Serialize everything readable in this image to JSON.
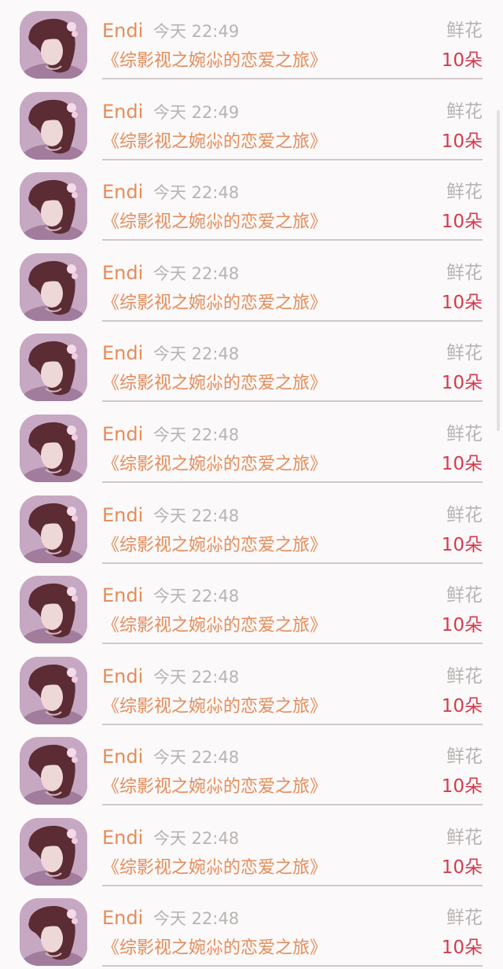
{
  "rows": [
    {
      "name": "Endi",
      "time": "今天 22:49",
      "type": "鲜花",
      "book": "《综影视之婉尛的恋爱之旅》",
      "amount": "10朵"
    },
    {
      "name": "Endi",
      "time": "今天 22:49",
      "type": "鲜花",
      "book": "《综影视之婉尛的恋爱之旅》",
      "amount": "10朵"
    },
    {
      "name": "Endi",
      "time": "今天 22:48",
      "type": "鲜花",
      "book": "《综影视之婉尛的恋爱之旅》",
      "amount": "10朵"
    },
    {
      "name": "Endi",
      "time": "今天 22:48",
      "type": "鲜花",
      "book": "《综影视之婉尛的恋爱之旅》",
      "amount": "10朵"
    },
    {
      "name": "Endi",
      "time": "今天 22:48",
      "type": "鲜花",
      "book": "《综影视之婉尛的恋爱之旅》",
      "amount": "10朵"
    },
    {
      "name": "Endi",
      "time": "今天 22:48",
      "type": "鲜花",
      "book": "《综影视之婉尛的恋爱之旅》",
      "amount": "10朵"
    },
    {
      "name": "Endi",
      "time": "今天 22:48",
      "type": "鲜花",
      "book": "《综影视之婉尛的恋爱之旅》",
      "amount": "10朵"
    },
    {
      "name": "Endi",
      "time": "今天 22:48",
      "type": "鲜花",
      "book": "《综影视之婉尛的恋爱之旅》",
      "amount": "10朵"
    },
    {
      "name": "Endi",
      "time": "今天 22:48",
      "type": "鲜花",
      "book": "《综影视之婉尛的恋爱之旅》",
      "amount": "10朵"
    },
    {
      "name": "Endi",
      "time": "今天 22:48",
      "type": "鲜花",
      "book": "《综影视之婉尛的恋爱之旅》",
      "amount": "10朵"
    },
    {
      "name": "Endi",
      "time": "今天 22:48",
      "type": "鲜花",
      "book": "《综影视之婉尛的恋爱之旅》",
      "amount": "10朵"
    },
    {
      "name": "Endi",
      "time": "今天 22:48",
      "type": "鲜花",
      "book": "《综影视之婉尛的恋爱之旅》",
      "amount": "10朵"
    }
  ],
  "colors": {
    "name": "#e58c5a",
    "book": "#e58c5a",
    "amount": "#d33b4f",
    "muted": "#b9b3b3",
    "divider": "#cfcaca",
    "background": "#fbf9f9"
  }
}
